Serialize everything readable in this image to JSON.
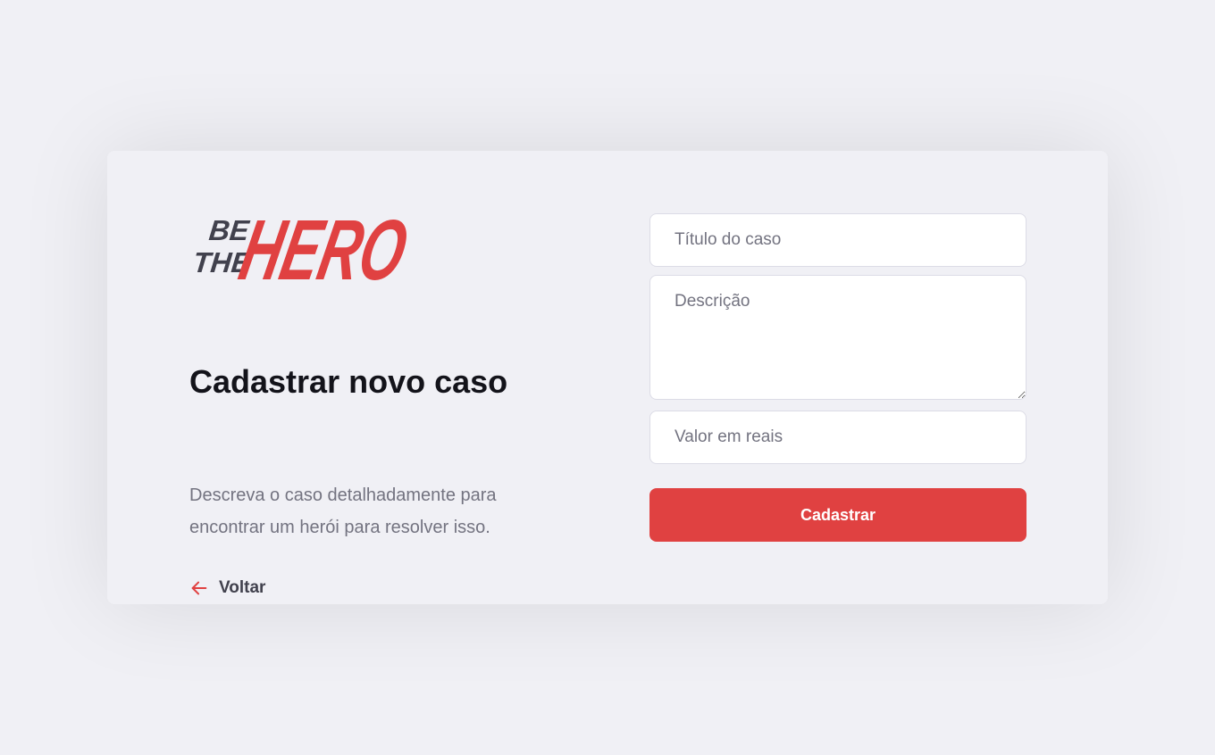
{
  "logo": {
    "small_line1": "BE",
    "small_line2": "THE",
    "big": "HERO"
  },
  "colors": {
    "accent": "#e04141",
    "dark": "#41414d",
    "background": "#f0f0f5"
  },
  "page": {
    "title": "Cadastrar novo caso",
    "description": "Descreva o caso detalhadamente para encontrar um herói para resolver isso.",
    "back_label": "Voltar",
    "back_icon": "arrow-left-icon"
  },
  "form": {
    "title_placeholder": "Título do caso",
    "description_placeholder": "Descrição",
    "value_placeholder": "Valor em reais",
    "submit_label": "Cadastrar"
  }
}
